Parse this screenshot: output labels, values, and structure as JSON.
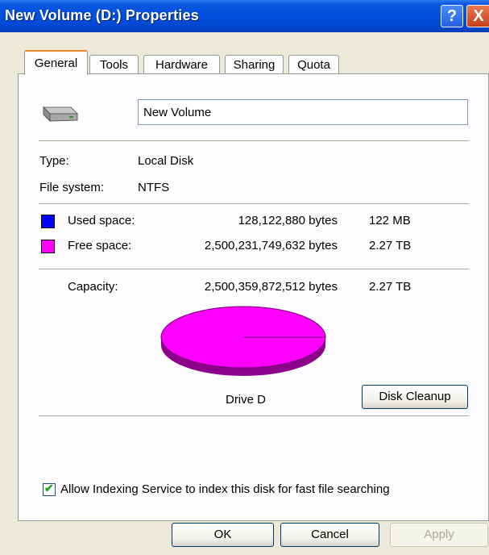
{
  "window": {
    "title": "New Volume (D:) Properties",
    "help_glyph": "?",
    "close_glyph": "X"
  },
  "tabs": [
    {
      "label": "General",
      "active": true
    },
    {
      "label": "Tools"
    },
    {
      "label": "Hardware"
    },
    {
      "label": "Sharing"
    },
    {
      "label": "Quota"
    }
  ],
  "general": {
    "drive_icon": "hard-drive-icon",
    "volume_name": "New Volume",
    "type_label": "Type:",
    "type_value": "Local Disk",
    "fs_label": "File system:",
    "fs_value": "NTFS",
    "used_label": "Used space:",
    "used_bytes": "128,122,880 bytes",
    "used_size": "122 MB",
    "used_color": "#0000ff",
    "free_label": "Free space:",
    "free_bytes": "2,500,231,749,632 bytes",
    "free_size": "2.27 TB",
    "free_color": "#ff00ff",
    "capacity_label": "Capacity:",
    "capacity_bytes": "2,500,359,872,512 bytes",
    "capacity_size": "2.27 TB",
    "drive_label": "Drive D",
    "disk_cleanup_label": "Disk Cleanup",
    "indexing_label": "Allow Indexing Service to index this disk for fast file searching",
    "indexing_checked": true
  },
  "chart_data": {
    "type": "pie",
    "categories": [
      "Used space",
      "Free space"
    ],
    "values": [
      128122880,
      2500231749632
    ],
    "colors": [
      "#0000ff",
      "#ff00ff"
    ]
  },
  "footer": {
    "ok_label": "OK",
    "cancel_label": "Cancel",
    "apply_label": "Apply"
  }
}
